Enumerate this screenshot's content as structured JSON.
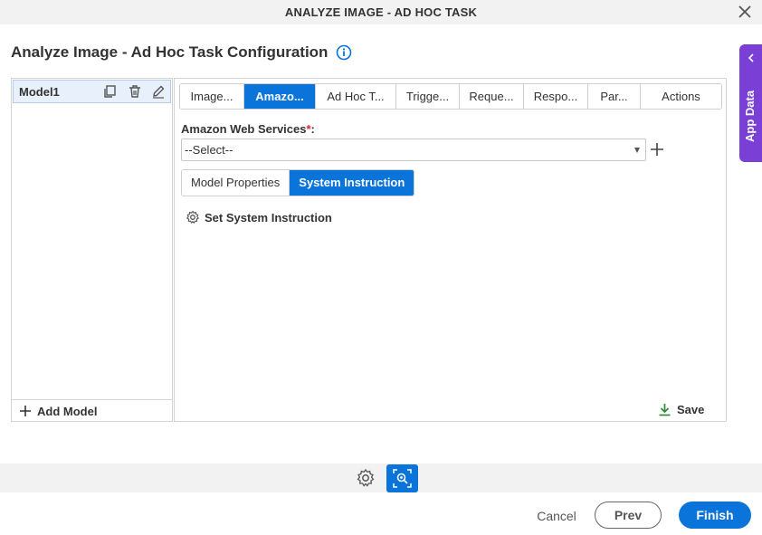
{
  "window": {
    "title": "ANALYZE IMAGE - AD HOC TASK",
    "close_icon": "close-icon"
  },
  "page": {
    "heading": "Analyze Image - Ad Hoc Task Configuration",
    "info_icon": "info-icon"
  },
  "side_tab": {
    "label": "App Data",
    "icon": "chevron-left-icon",
    "color": "#7a3fd4"
  },
  "models": {
    "items": [
      {
        "label": "Model1"
      }
    ],
    "actions": [
      "copy-icon",
      "delete-icon",
      "edit-icon"
    ],
    "add_label": "Add Model"
  },
  "tabs": [
    {
      "label": "Image...",
      "active": false
    },
    {
      "label": "Amazo...",
      "active": true
    },
    {
      "label": "Ad Hoc T...",
      "active": false
    },
    {
      "label": "Trigge...",
      "active": false
    },
    {
      "label": "Reque...",
      "active": false
    },
    {
      "label": "Respo...",
      "active": false
    },
    {
      "label": "Par...",
      "active": false
    },
    {
      "label": "Actions",
      "active": false
    }
  ],
  "aws_field": {
    "label": "Amazon Web Services",
    "required_mark": "*",
    "suffix": ":",
    "selected": "--Select--"
  },
  "subtabs": [
    {
      "label": "Model Properties",
      "active": false
    },
    {
      "label": "System Instruction",
      "active": true
    }
  ],
  "system_instruction": {
    "label": "Set System Instruction"
  },
  "save": {
    "label": "Save"
  },
  "footer": {
    "cancel": "Cancel",
    "prev": "Prev",
    "finish": "Finish"
  },
  "colors": {
    "accent": "#0a74da",
    "required": "#d9232e",
    "save_icon": "#2e8b3a"
  }
}
